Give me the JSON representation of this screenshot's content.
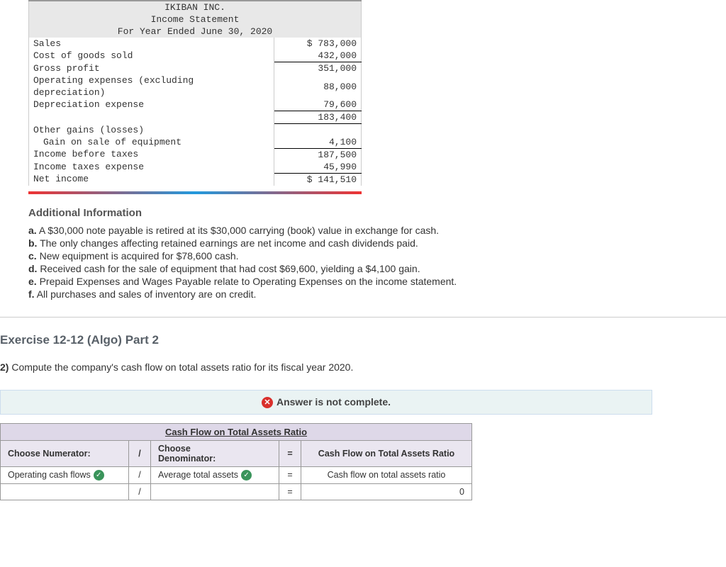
{
  "income": {
    "company": "IKIBAN INC.",
    "title": "Income Statement",
    "period": "For Year Ended June 30, 2020",
    "rows": {
      "sales_l": "Sales",
      "sales_v": "$ 783,000",
      "cogs_l": "Cost of goods sold",
      "cogs_v": "432,000",
      "gp_l": "Gross profit",
      "gp_v": "351,000",
      "opex_l1": "Operating expenses (excluding",
      "opex_l2": "depreciation)",
      "opex_v": "88,000",
      "dep_l": "Depreciation expense",
      "dep_v": "79,600",
      "sub1_v": "183,400",
      "other_l": "Other gains (losses)",
      "gain_l": "Gain on sale of equipment",
      "gain_v": "4,100",
      "ibt_l": "Income before taxes",
      "ibt_v": "187,500",
      "tax_l": "Income taxes expense",
      "tax_v": "45,990",
      "ni_l": "Net income",
      "ni_v": "$ 141,510"
    }
  },
  "addl": {
    "heading": "Additional Information",
    "items": {
      "a": "A $30,000 note payable is retired at its $30,000 carrying (book) value in exchange for cash.",
      "b": "The only changes affecting retained earnings are net income and cash dividends paid.",
      "c": "New equipment is acquired for $78,600 cash.",
      "d": "Received cash for the sale of equipment that had cost $69,600, yielding a $4,100 gain.",
      "e": "Prepaid Expenses and Wages Payable relate to Operating Expenses on the income statement.",
      "f": "All purchases and sales of inventory are on credit."
    }
  },
  "exercise": {
    "title": "Exercise 12-12 (Algo) Part 2",
    "prompt_num": "2)",
    "prompt": " Compute the company's cash flow on total assets ratio for its fiscal year 2020."
  },
  "feedback": {
    "msg": "Answer is not complete."
  },
  "ratio": {
    "header": "Cash Flow on Total Assets Ratio",
    "num_hdr": "Choose Numerator:",
    "den_hdr": "Choose\nDenominator:",
    "res_hdr": "Cash Flow on Total Assets Ratio",
    "slash": "/",
    "eq": "=",
    "row1_num": "Operating cash flows",
    "row1_den": "Average total assets",
    "row1_res": "Cash flow on total assets ratio",
    "row2_num": "",
    "row2_den": "",
    "row2_res": "0"
  }
}
